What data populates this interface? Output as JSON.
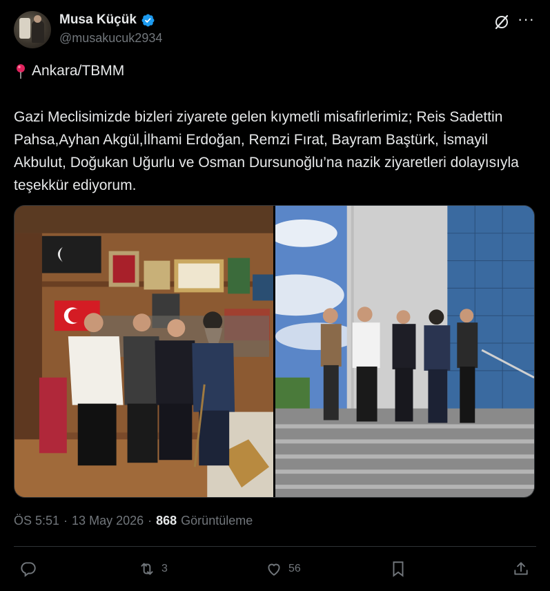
{
  "author": {
    "display_name": "Musa Küçük",
    "handle": "@musakucuk2934",
    "verified": true,
    "verified_color": "#1d9bf0",
    "avatar_icon": "avatar-photo"
  },
  "header_icons": [
    "grok-icon",
    "more-icon"
  ],
  "post": {
    "location": "Ankara/TBMM",
    "location_icon": "round-pushpin-icon",
    "body": "Gazi Meclisimizde bizleri ziyarete gelen kıymetli misafirlerimiz; Reis Sadettin Pahsa,Ayhan Akgül,İlhami Erdoğan, Remzi Fırat, Bayram Baştürk, İsmayil Akbulut, Doğukan Uğurlu ve Osman Dursunoğlu’na nazik ziyaretleri dolayısıyla teşekkür ediyorum.",
    "photos": [
      "office-group-photo",
      "building-steps-group-photo"
    ]
  },
  "meta": {
    "time": "ÖS 5:51",
    "date": "13 May 2026",
    "separator": "·",
    "views_count": "868",
    "views_label": "Görüntüleme"
  },
  "actions": {
    "reply_count": "",
    "repost_count": "3",
    "like_count": "56",
    "bookmark_count": "",
    "icons": [
      "reply-icon",
      "repost-icon",
      "like-icon",
      "bookmark-icon",
      "share-icon"
    ]
  },
  "colors": {
    "background": "#000000",
    "text": "#e7e9ea",
    "secondary_text": "#71767b",
    "divider": "#2f3336",
    "accent": "#1d9bf0"
  }
}
